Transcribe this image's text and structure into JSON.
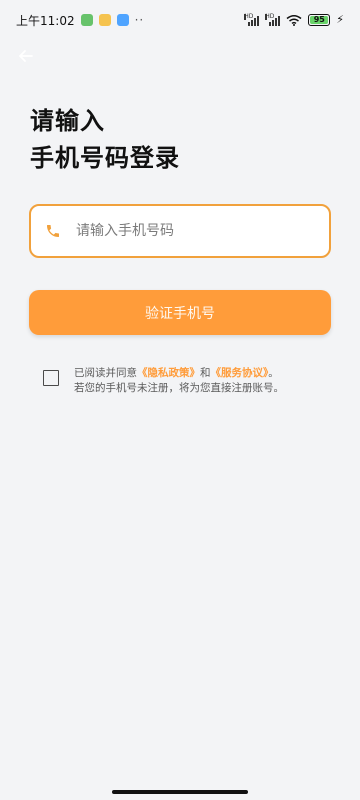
{
  "status_bar": {
    "time": "上午11:02",
    "extra_dots": "··",
    "hd_label_1": "HD",
    "hd_label_2": "HD",
    "battery": "95",
    "charging_symbol": "⚡",
    "battery_color": "#69d36a"
  },
  "header": {
    "title_line1": "请输入",
    "title_line2": "手机号码登录"
  },
  "phone_field": {
    "placeholder": "请输入手机号码",
    "icon": "phone-icon"
  },
  "verify_button": {
    "label": "验证手机号"
  },
  "agreement": {
    "prefix": "已阅读并同意",
    "privacy_link": "《隐私政策》",
    "and": "和",
    "service_link": "《服务协议》",
    "suffix": "。",
    "note": "若您的手机号未注册，将为您直接注册账号。"
  },
  "colors": {
    "accent": "#ff9c3a",
    "field_border": "#f1a13c",
    "background": "#f3f4f6"
  }
}
